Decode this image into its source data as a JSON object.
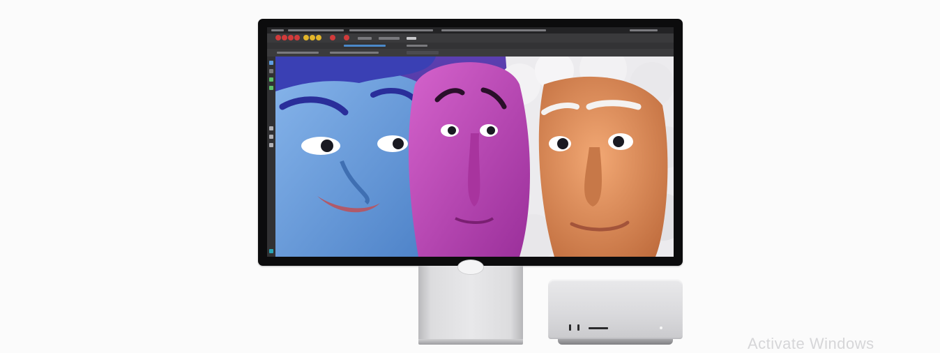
{
  "scene": {
    "background": "#fbfbfb",
    "monitor_bezel_color": "#0c0c0d",
    "stand_color": "#dcdcde",
    "studio_color": "#dcdcde"
  },
  "screen": {
    "app_background": "#2b2b2d",
    "viewport_faces": [
      {
        "name": "blue-face",
        "color": "#6f9fd8"
      },
      {
        "name": "magenta-face",
        "color": "#c046b8"
      },
      {
        "name": "orange-face",
        "color": "#d98a5a"
      }
    ],
    "hair_colors": {
      "blue": "#3a40b4",
      "white": "#ecebee"
    }
  },
  "overlay": {
    "watermark_text": "Activate Windows"
  }
}
